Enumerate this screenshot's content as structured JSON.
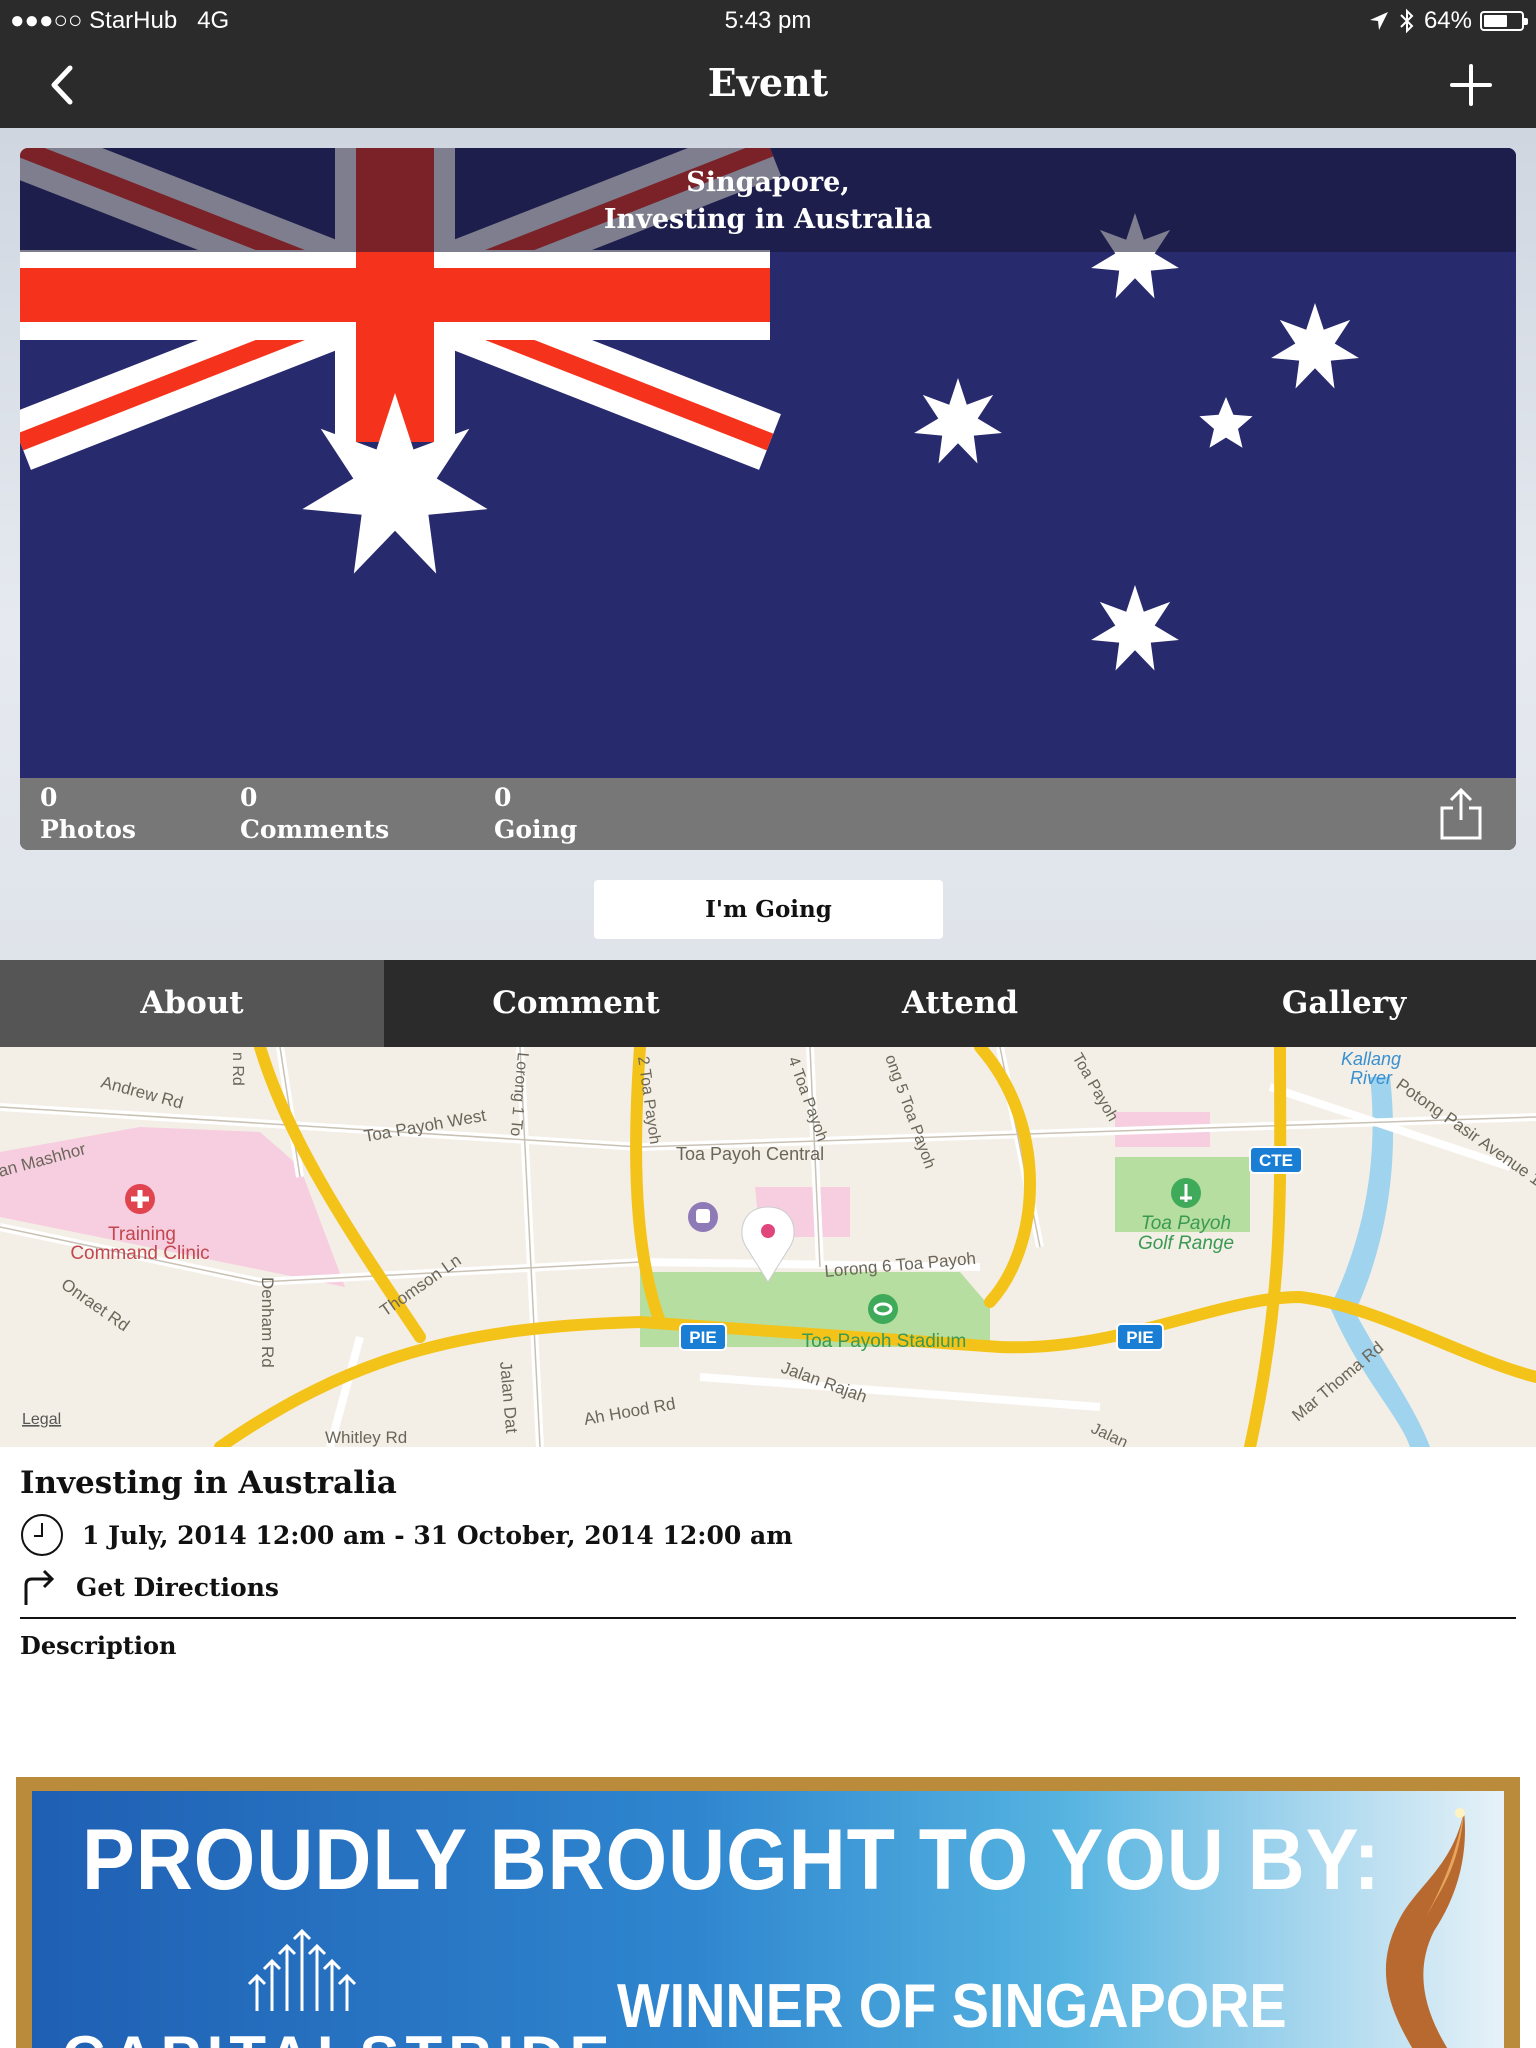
{
  "status_bar": {
    "carrier": "●●●○○ StarHub   4G",
    "time": "5:43 pm",
    "battery": "64%",
    "battery_level": 0.64
  },
  "nav": {
    "title": "Event"
  },
  "event_card": {
    "overlay_line1": "Singapore,",
    "overlay_line2": "Investing in Australia",
    "stats": [
      {
        "count": "0",
        "label": "Photos"
      },
      {
        "count": "0",
        "label": "Comments"
      },
      {
        "count": "0",
        "label": "Going"
      }
    ]
  },
  "going_button": "I'm Going",
  "tabs": [
    "About",
    "Comment",
    "Attend",
    "Gallery"
  ],
  "map": {
    "labels": {
      "andrew": "Andrew Rd",
      "tpwest": "Toa Payoh West",
      "tpcentral": "Toa Payoh Central",
      "mashhor": "an Mashhor",
      "clinic1": "Training",
      "clinic2": "Command Clinic",
      "onraet": "Onraet Rd",
      "denham": "Denham Rd",
      "thomson": "Thomson Ln",
      "jalandat": "Jalan Dat",
      "ahhood": "Ah Hood Rd",
      "whitley": "Whitley Rd",
      "lorong6": "Lorong 6 Toa Payoh",
      "stadium": "Toa Payoh Stadium",
      "jalanrajah": "Jalan Rajah",
      "golf1": "Toa Payoh",
      "golf2": "Golf Range",
      "kallang1": "Kallang",
      "kallang2": "River",
      "potong": "Potong Pasir Avenue 1",
      "marthoma": "Mar Thoma Rd",
      "pie": "PIE",
      "cte": "CTE",
      "legal": "Legal",
      "tp2": "2 Toa Payoh",
      "tp4": "4 Toa Payoh",
      "tp5": "ong 5 Toa Payoh",
      "lorong1": "Lorong 1 To",
      "rd": "n Rd",
      "tpa": "Toa Payoh",
      "jalan": "Jalan"
    }
  },
  "details": {
    "title": "Investing in Australia",
    "date_range": "1 July, 2014 12:00 am - 31 October, 2014 12:00 am",
    "directions": "Get Directions",
    "description_label": "Description"
  },
  "banner": {
    "headline": "PROUDLY BROUGHT TO YOU BY:",
    "winner": "WINNER OF SINGAPORE",
    "brand": "CAPITALSTRIDE"
  },
  "colors": {
    "navbar": "#2b2b2b",
    "tab_active": "#555555",
    "flag_blue": "#282a6e",
    "flag_red": "#f5331c",
    "map_road_yellow": "#f4c31a",
    "map_park_green": "#b6dea0",
    "map_pink": "#f7cde0",
    "pie_badge": "#1a7fd4"
  }
}
